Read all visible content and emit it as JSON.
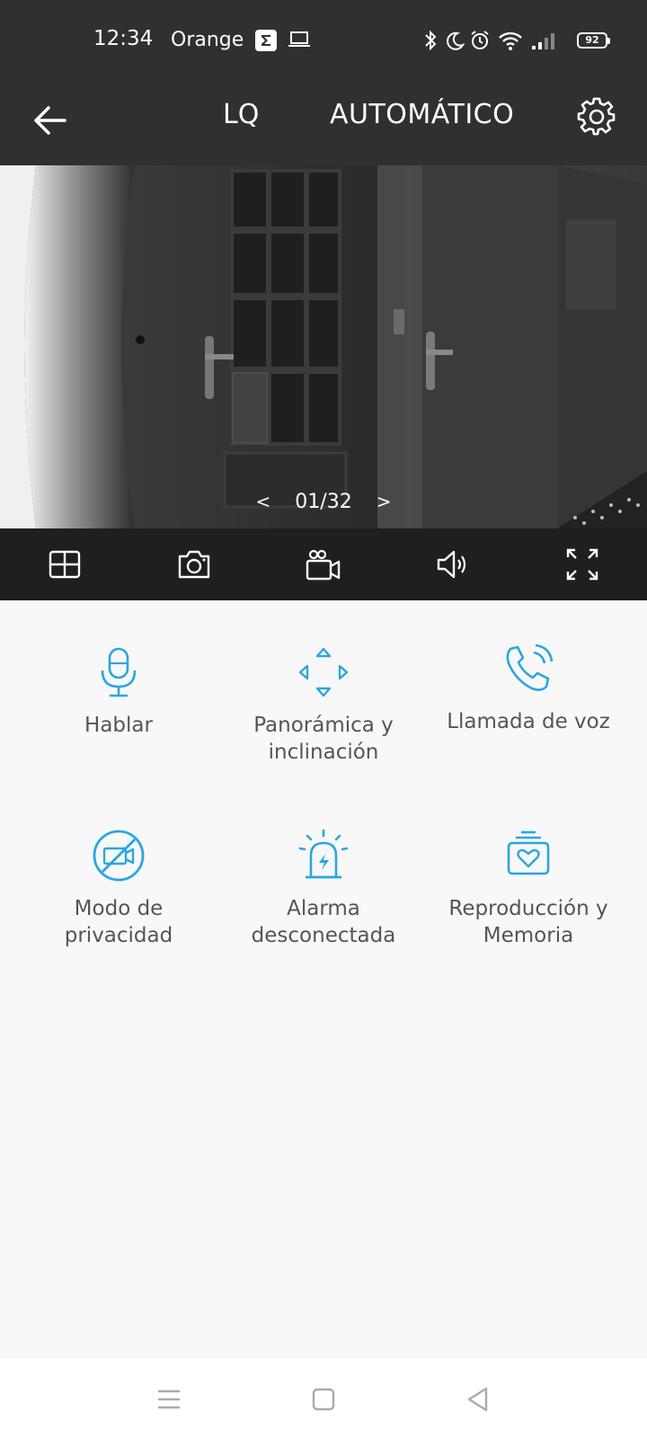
{
  "status_bar": {
    "time": "12:34",
    "carrier": "Orange",
    "battery": "92",
    "icons": [
      "app-icon",
      "laptop-icon",
      "bluetooth-icon",
      "moon-icon",
      "alarm-icon",
      "wifi-icon",
      "signal-icon",
      "battery-icon"
    ]
  },
  "header": {
    "quality_label": "LQ",
    "mode_label": "AUTOMÁTICO",
    "icons": [
      "back-arrow-icon",
      "gear-icon"
    ]
  },
  "video": {
    "page_indicator": "01/32",
    "prev_label": "<",
    "next_label": ">"
  },
  "toolbar": {
    "icons": [
      "grid-view-icon",
      "camera-icon",
      "video-record-icon",
      "speaker-icon",
      "fullscreen-icon"
    ]
  },
  "features": [
    {
      "label": "Hablar",
      "icon": "microphone-icon"
    },
    {
      "label": "Panorámica y\ninclinación",
      "icon": "pan-tilt-icon"
    },
    {
      "label": "Llamada de voz",
      "icon": "phone-call-icon"
    },
    {
      "label": "Modo de\nprivacidad",
      "icon": "privacy-icon"
    },
    {
      "label": "Alarma\ndesconectada",
      "icon": "alarm-siren-icon"
    },
    {
      "label": "Reproducción y\nMemoria",
      "icon": "playback-memory-icon"
    }
  ],
  "colors": {
    "header_bg": "#303030",
    "toolbar_bg": "#1f1f1f",
    "accent": "#2aa6e0",
    "page_bg": "#f8f8f8",
    "label": "#555555"
  }
}
